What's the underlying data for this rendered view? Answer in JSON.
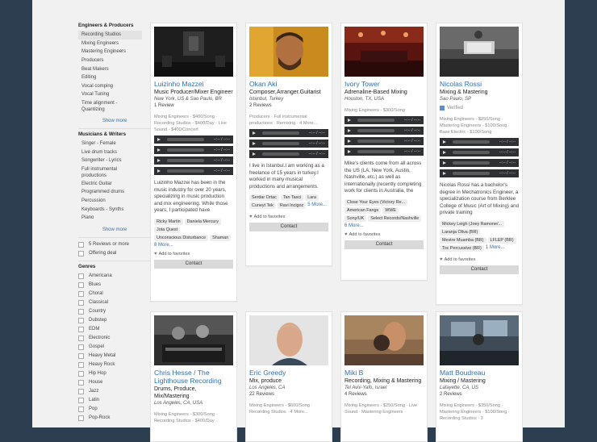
{
  "sidebar": {
    "section1_title": "Engineers & Producers",
    "section1_items": [
      "Recording Studios",
      "Mixing Engineers",
      "Mastering Engineers",
      "Producers",
      "Beat Makers",
      "Editing",
      "Vocal comping",
      "Vocal Tuning",
      "Time alignment - Quantizing"
    ],
    "show_more": "Show more",
    "section2_title": "Musicians & Writers",
    "section2_items": [
      "Singer - Female",
      "Live drum tracks",
      "Songwriter - Lyrics",
      "Full instrumental productions",
      "Electric Guitar",
      "Programmed drums",
      "Percussion",
      "Keyboards - Synths",
      "Piano"
    ],
    "filter1": "5 Reviews or more",
    "filter2": "Offering deal",
    "genres_title": "Genres",
    "genres": [
      "Americana",
      "Blues",
      "Choral",
      "Classical",
      "Country",
      "Dubstep",
      "EDM",
      "Electronic",
      "Gospel",
      "Heavy Metal",
      "Heavy Rock",
      "Hip Hop",
      "House",
      "Jazz",
      "Latin",
      "Pop",
      "Pop-Rock"
    ]
  },
  "cards": [
    {
      "name": "Luizinho Mazzei",
      "role": "Music Producer/Mixer Engineer",
      "location": "New York, US & Sao Paulo, BR",
      "reviews": "1 Review",
      "services": "Mixing Engineers - $400/Song · Recording Studios - $400/Day · Live Sound - $400/Concert",
      "track_time": "--:-- / --:--",
      "description": "Luizinho Mazzei has been in the music industry for over 20 years, specializing in music production and mix engineering. While those years, I participated have",
      "tags": [
        "Ricky Martin",
        "Daniela Mercury",
        "Jota Quest",
        "Unconscious Disturbance",
        "Shaman"
      ],
      "more": "8 More...",
      "favorites": "Add to favorites",
      "contact": "Contact"
    },
    {
      "name": "Okan Aki",
      "role": "Composer,Arranger.Guitarist",
      "location": "Istanbul, Turkey",
      "reviews": "2 Reviews",
      "services": "Producers · Full instrumental productions · Remixing · 4 More...",
      "track_time": "--:-- / --:--",
      "description": "I live in Istanbul.I am working as a freelance of 15 years in turkey.I worked in many musical productions and arrangements.",
      "tags": [
        "Serdar Ortac",
        "Tan Tasci",
        "Lara",
        "Cuneyt Tek",
        "Ravi Incigoz"
      ],
      "more": "5 More...",
      "favorites": "Add to favorites",
      "contact": "Contact"
    },
    {
      "name": "Ivory Tower",
      "role": "Adrenaline-Based Mixing",
      "location": "Houston, TX, USA",
      "reviews": "",
      "services": "Mixing Engineers - $300/Song",
      "track_time": "--:-- / --:--",
      "description": "Mike's clients come from all across the US (LA, New York, Austin, Nashville, etc.) as well as internationally (recently completing work for clients in Australia, the",
      "tags": [
        "Close Your Eyes (Victory Re...",
        "American Fangs",
        "WWE",
        "Sony/UK",
        "Select Records/Nashville"
      ],
      "more": "6 More...",
      "favorites": "Add to favorites",
      "contact": "Contact"
    },
    {
      "name": "Nicolas Rossi",
      "role": "Mixing & Mastering",
      "location": "Sao Paulo, SP",
      "reviews": "",
      "verified": "Verified",
      "services": "Mixing Engineers - $250/Song · Mastering Engineers - $100/Song · Bass Electric - $100/Song",
      "track_time": "--:-- / --:--",
      "description": "Nicolas Rossi has a bachelor's degree in Mechatronics Engineer, a specialization course from Berklee College of Music (Art of Mixing) and private training",
      "tags": [
        "Mickey Leigh (Joey Ramone/...",
        "Laranja Oliva (BR)",
        "Mestre Muamba (BR)",
        "LFLEP (BR)",
        "Toc Percussivo (BR)"
      ],
      "more": "1 More...",
      "favorites": "Add to favorites",
      "contact": "Contact"
    },
    {
      "name": "Chris Hesse / The Lighthouse Recording",
      "role": "Drums, Produce, Mix/Mastering",
      "location": "Los Angeles, CA, USA",
      "reviews": "",
      "services": "Mixing Engineers - $300/Song · Recording Studios - $400/Day ·",
      "more": "",
      "favorites": "",
      "contact": ""
    },
    {
      "name": "Eric Greedy",
      "role": "Mix, produce",
      "location": "Los Angeles, CA",
      "reviews": "22 Reviews",
      "services": "Mixing Engineers - $600/Song · Recording Studios · 4 More...",
      "more": "",
      "favorites": "",
      "contact": ""
    },
    {
      "name": "Miki B",
      "role": "Recording, Mixing & Mastering",
      "location": "Tel Aviv-Yafo, Israel",
      "reviews": "4 Reviews",
      "services": "Mixing Engineers - $250/Song · Live Sound · Mastering Engineers ·",
      "more": "",
      "favorites": "",
      "contact": ""
    },
    {
      "name": "Matt Boudreau",
      "role": "Mixing / Mastering",
      "location": "Lafayette, CA, US",
      "reviews": "2 Reviews",
      "services": "Mixing Engineers - $350/Song · Mastering Engineers - $100/Song · Recording Studios · 3",
      "more": "",
      "favorites": "",
      "contact": ""
    }
  ]
}
